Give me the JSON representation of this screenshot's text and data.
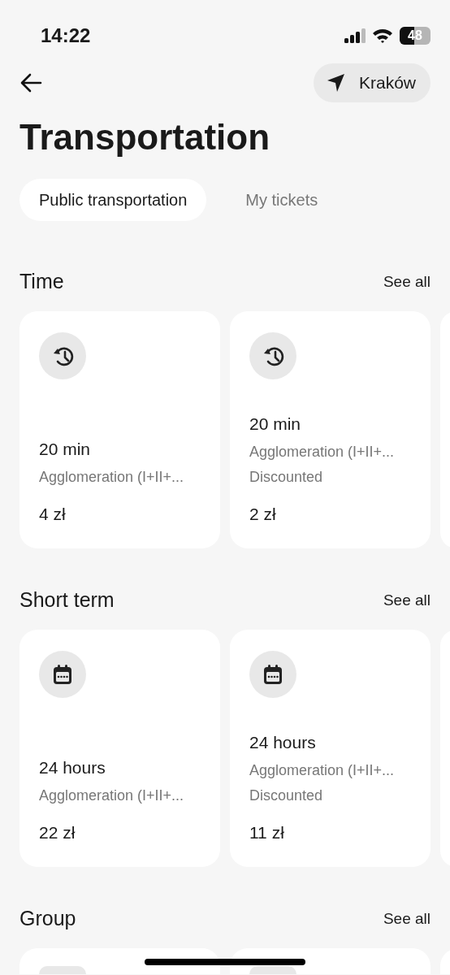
{
  "status_bar": {
    "time": "14:22",
    "battery": "48"
  },
  "header": {
    "location": "Kraków"
  },
  "title": "Transportation",
  "tabs": [
    {
      "label": "Public transportation",
      "selected": true
    },
    {
      "label": "My tickets",
      "selected": false
    }
  ],
  "sections": [
    {
      "title": "Time",
      "link": "See all",
      "more_cards_cut": true,
      "cards": [
        {
          "kind": "timed",
          "name": "20 min",
          "lines": [
            "Agglomeration (I+II+..."
          ],
          "price": "4 zł"
        },
        {
          "kind": "timed",
          "name": "20 min",
          "lines": [
            "Agglomeration (I+II+...",
            "Discounted"
          ],
          "price": "2 zł"
        }
      ]
    },
    {
      "title": "Short term",
      "link": "See all",
      "more_cards_cut": true,
      "cards": [
        {
          "kind": "daily",
          "name": "24 hours",
          "lines": [
            "Agglomeration (I+II+..."
          ],
          "price": "22 zł"
        },
        {
          "kind": "daily",
          "name": "24 hours",
          "lines": [
            "Agglomeration (I+II+...",
            "Discounted"
          ],
          "price": "11 zł"
        }
      ]
    },
    {
      "title": "Group",
      "link": "See all",
      "cards": [
        {
          "kind": "cut"
        },
        {
          "kind": "cut"
        },
        {
          "kind": "cut"
        }
      ]
    }
  ]
}
